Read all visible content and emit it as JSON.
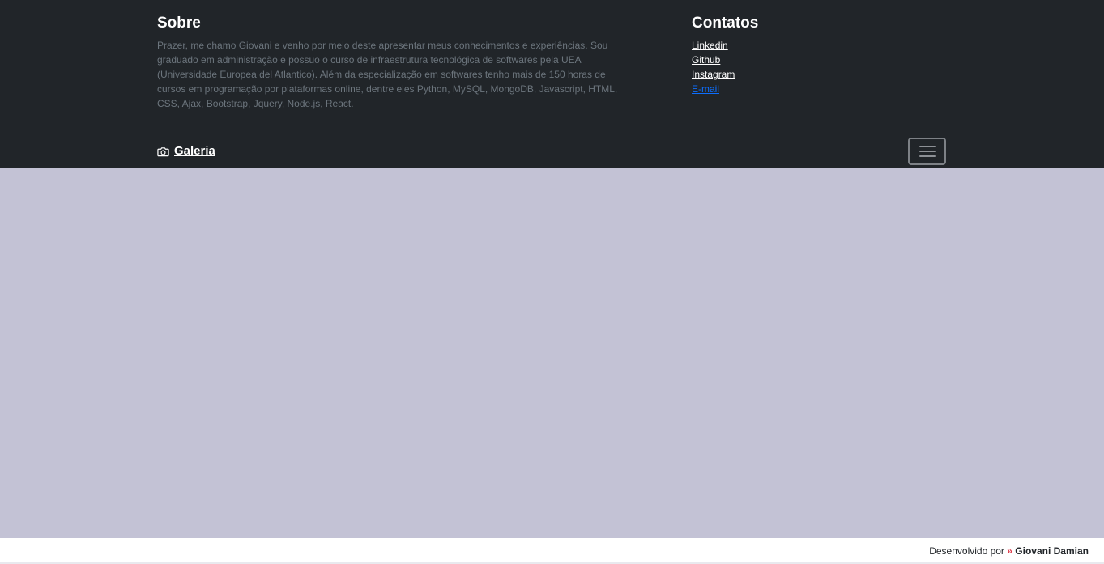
{
  "about": {
    "heading": "Sobre",
    "text": "Prazer, me chamo Giovani e venho por meio deste apresentar meus conhecimentos e experiências. Sou graduado em administração e possuo o curso de infraestrutura tecnológica de softwares pela UEA (Universidade Europea del Atlantico). Além da especialização em softwares tenho mais de 150 horas de cursos em programação por plataformas online, dentre eles Python, MySQL, MongoDB, Javascript, HTML, CSS, Ajax, Bootstrap, Jquery, Node.js, React."
  },
  "contacts": {
    "heading": "Contatos",
    "links": [
      "Linkedin",
      "Github",
      "Instagram",
      "E-mail"
    ]
  },
  "navbar": {
    "brand_label": "Galeria",
    "brand_icon": "camera-icon",
    "toggler_icon": "hamburger-menu-icon"
  },
  "footer": {
    "prefix": "Desenvolvido por",
    "arrow": "»",
    "author": "Giovani Damian"
  },
  "colors": {
    "header_bg": "#212529",
    "main_bg": "#c3c2d5",
    "link_blue": "#0d6efd",
    "accent_red": "#dc3545"
  }
}
